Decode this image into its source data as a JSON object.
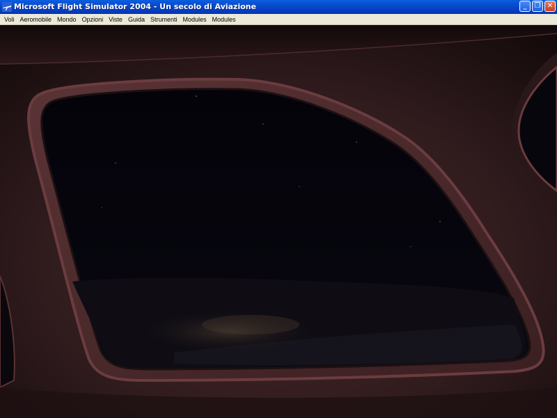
{
  "window": {
    "title": "Microsoft Flight Simulator 2004 - Un secolo di Aviazione",
    "app_icon": "plane-icon",
    "controls": {
      "minimize": "_",
      "restore": "❐",
      "close": "✕"
    }
  },
  "menu": {
    "items": [
      {
        "label": "Voli"
      },
      {
        "label": "Aeromobile"
      },
      {
        "label": "Mondo"
      },
      {
        "label": "Opzioni"
      },
      {
        "label": "Viste"
      },
      {
        "label": "Guida"
      },
      {
        "label": "Strumenti"
      },
      {
        "label": "Modules"
      },
      {
        "label": "Modules"
      }
    ]
  },
  "scene": {
    "cockpit_color": "#3a2224",
    "night_sky_color": "#05040a",
    "ground_color": "#141018"
  }
}
